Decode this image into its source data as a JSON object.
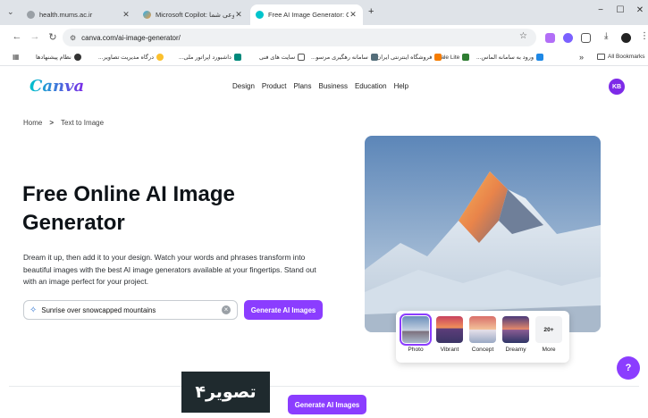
{
  "browser": {
    "tabs": [
      {
        "title": "health.mums.ac.ir",
        "active": false
      },
      {
        "title": "Microsoft Copilot: دستیار هوش مصنوعی شما",
        "active": false
      },
      {
        "title": "Free AI Image Generator: Online",
        "active": true
      }
    ],
    "new_tab": "+",
    "url": "canva.com/ai-image-generator/",
    "bookmarks": [
      "ورود به سامانه الماس...",
      "Bale Lite",
      "فروشگاه اینترنتی ایران...",
      "سامانه رهگیری مرسو...",
      "سایت های فنی",
      "داشبورد اپراتور ملی...",
      "درگاه مدیریت تصاویر...",
      "نظام پیشنهادها"
    ],
    "all_bookmarks": "All Bookmarks",
    "overflow": "»"
  },
  "site": {
    "logo": "Canva",
    "nav": [
      "Design",
      "Product",
      "Plans",
      "Business",
      "Education",
      "Help"
    ],
    "avatar": "KB"
  },
  "breadcrumb": {
    "home": "Home",
    "sep": ">",
    "current": "Text to Image"
  },
  "hero": {
    "headline": "Free Online AI Image Generator",
    "description": "Dream it up, then add it to your design. Watch your words and phrases transform into beautiful images with the best AI image generators available at your fingertips. Stand out with an image perfect for your project.",
    "search_value": "Sunrise over snowcapped mountains",
    "generate_label": "Generate AI Images"
  },
  "styles": [
    {
      "label": "Photo",
      "selected": true
    },
    {
      "label": "Vibrant",
      "selected": false
    },
    {
      "label": "Concept",
      "selected": false
    },
    {
      "label": "Dreamy",
      "selected": false
    },
    {
      "label": "More",
      "count": "20+",
      "selected": false
    }
  ],
  "help_label": "?",
  "footer_generate_label": "Generate AI Images",
  "overlay_label": "تصویر۴",
  "colors": {
    "accent": "#8b3dff",
    "avatar": "#7d2ae8"
  }
}
